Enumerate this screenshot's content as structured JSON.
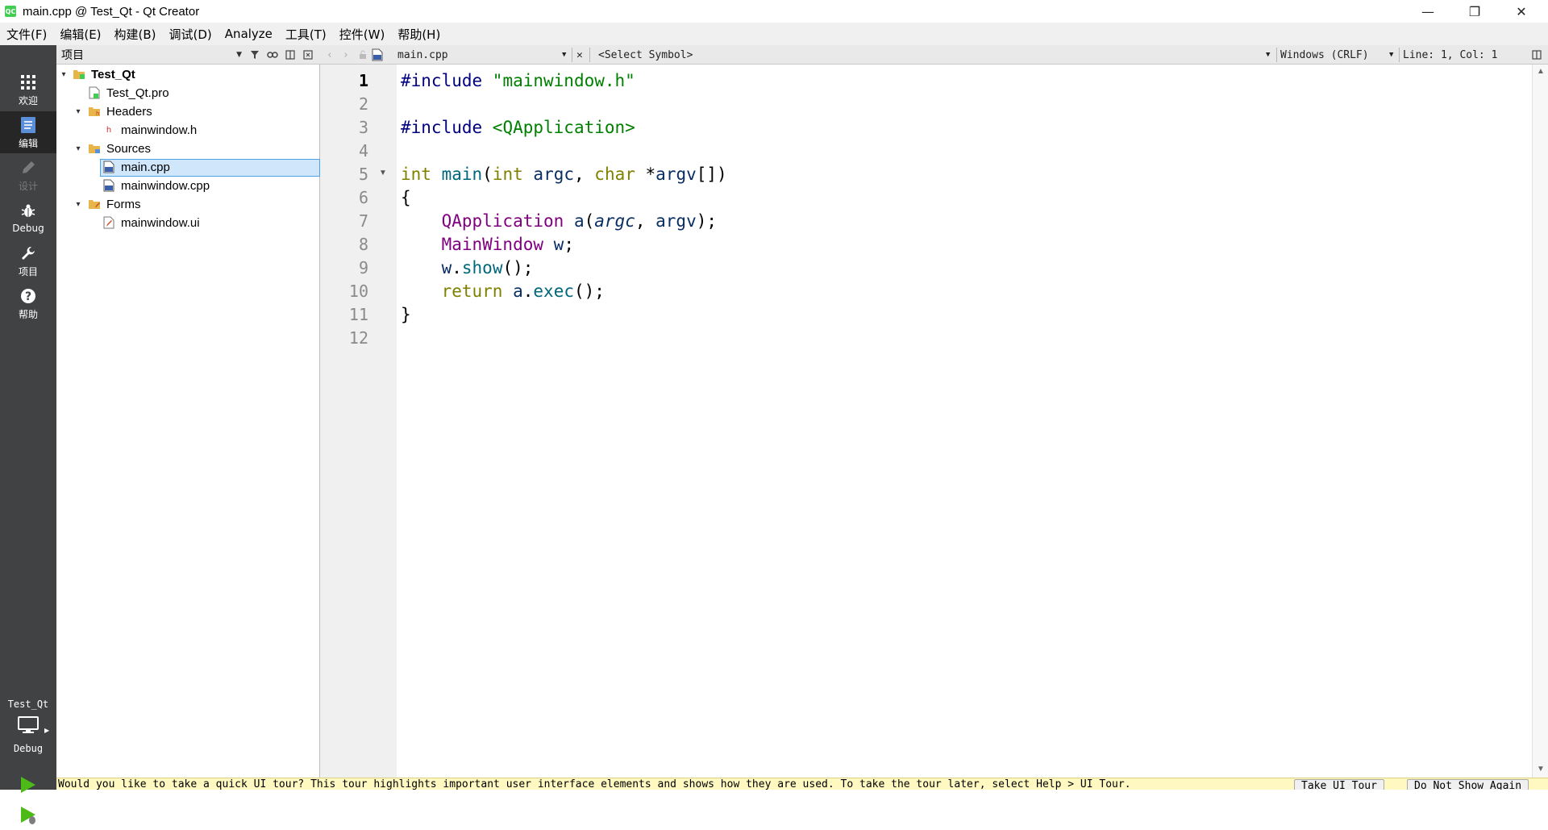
{
  "window": {
    "title": "main.cpp @ Test_Qt - Qt Creator",
    "app_icon_text": "QC",
    "minimize": "—",
    "restore": "❐",
    "close": "✕"
  },
  "menu": [
    "文件(F)",
    "编辑(E)",
    "构建(B)",
    "调试(D)",
    "Analyze",
    "工具(T)",
    "控件(W)",
    "帮助(H)"
  ],
  "modes": [
    {
      "label": "欢迎",
      "icon": "grid-icon",
      "state": "normal"
    },
    {
      "label": "编辑",
      "icon": "document-icon",
      "state": "active"
    },
    {
      "label": "设计",
      "icon": "pencil-icon",
      "state": "disabled"
    },
    {
      "label": "Debug",
      "icon": "bug-icon",
      "state": "normal"
    },
    {
      "label": "项目",
      "icon": "wrench-icon",
      "state": "normal"
    },
    {
      "label": "帮助",
      "icon": "help-icon",
      "state": "normal"
    }
  ],
  "kit": {
    "project": "Test_Qt",
    "build": "Debug"
  },
  "project_panel": {
    "view": "项目",
    "tree": [
      {
        "label": "Test_Qt",
        "bold": true,
        "icon": "project-folder-icon",
        "expanded": true,
        "chevron": "▾"
      },
      {
        "label": "Test_Qt.pro",
        "icon": "pro-file-icon"
      },
      {
        "label": "Headers",
        "icon": "headers-folder-icon",
        "expanded": true,
        "chevron": "▾"
      },
      {
        "label": "mainwindow.h",
        "icon": "header-file-icon",
        "icon_text": "h"
      },
      {
        "label": "Sources",
        "icon": "sources-folder-icon",
        "expanded": true,
        "chevron": "▾"
      },
      {
        "label": "main.cpp",
        "icon": "cpp-file-icon",
        "selected": true
      },
      {
        "label": "mainwindow.cpp",
        "icon": "cpp-file-icon"
      },
      {
        "label": "Forms",
        "icon": "forms-folder-icon",
        "expanded": true,
        "chevron": "▾"
      },
      {
        "label": "mainwindow.ui",
        "icon": "ui-file-icon"
      }
    ]
  },
  "editor": {
    "file": "main.cpp",
    "symbol": "<Select Symbol>",
    "line_ending": "Windows (CRLF)",
    "cursor": "Line: 1, Col: 1",
    "line_numbers": [
      "1",
      "2",
      "3",
      "4",
      "5",
      "6",
      "7",
      "8",
      "9",
      "10",
      "11",
      "12"
    ],
    "current_line": 1,
    "code": [
      [
        {
          "t": "#include ",
          "c": "pp"
        },
        {
          "t": "\"mainwindow.h\"",
          "c": "str"
        }
      ],
      [],
      [
        {
          "t": "#include ",
          "c": "pp"
        },
        {
          "t": "<QApplication>",
          "c": "str"
        }
      ],
      [],
      [
        {
          "t": "int",
          "c": "kw"
        },
        {
          "t": " "
        },
        {
          "t": "main",
          "c": "fn"
        },
        {
          "t": "("
        },
        {
          "t": "int",
          "c": "kw"
        },
        {
          "t": " "
        },
        {
          "t": "argc",
          "c": "lv"
        },
        {
          "t": ", "
        },
        {
          "t": "char",
          "c": "kw"
        },
        {
          "t": " *"
        },
        {
          "t": "argv",
          "c": "lv"
        },
        {
          "t": "[])"
        }
      ],
      [
        {
          "t": "{"
        }
      ],
      [
        {
          "t": "    "
        },
        {
          "t": "QApplication",
          "c": "ty"
        },
        {
          "t": " "
        },
        {
          "t": "a",
          "c": "lv"
        },
        {
          "t": "("
        },
        {
          "t": "argc",
          "c": "par"
        },
        {
          "t": ", "
        },
        {
          "t": "argv",
          "c": "lv"
        },
        {
          "t": ");"
        }
      ],
      [
        {
          "t": "    "
        },
        {
          "t": "MainWindow",
          "c": "ty"
        },
        {
          "t": " "
        },
        {
          "t": "w",
          "c": "lv"
        },
        {
          "t": ";"
        }
      ],
      [
        {
          "t": "    "
        },
        {
          "t": "w",
          "c": "lv"
        },
        {
          "t": "."
        },
        {
          "t": "show",
          "c": "fn"
        },
        {
          "t": "();"
        }
      ],
      [
        {
          "t": "    "
        },
        {
          "t": "return",
          "c": "kw"
        },
        {
          "t": " "
        },
        {
          "t": "a",
          "c": "lv"
        },
        {
          "t": "."
        },
        {
          "t": "exec",
          "c": "fn"
        },
        {
          "t": "();"
        }
      ],
      [
        {
          "t": "}"
        }
      ],
      []
    ]
  },
  "infobar": {
    "message": "Would you like to take a quick UI tour? This tour highlights important user interface elements and shows how they are used. To take the tour later, select Help > UI Tour.",
    "take_tour": "Take UI Tour",
    "dont_show": "Do Not Show Again"
  },
  "colors": {
    "accent": "#4aa3e8",
    "mode_bar": "#404244",
    "mode_active": "#262626",
    "selection": "#cfe6fb"
  }
}
